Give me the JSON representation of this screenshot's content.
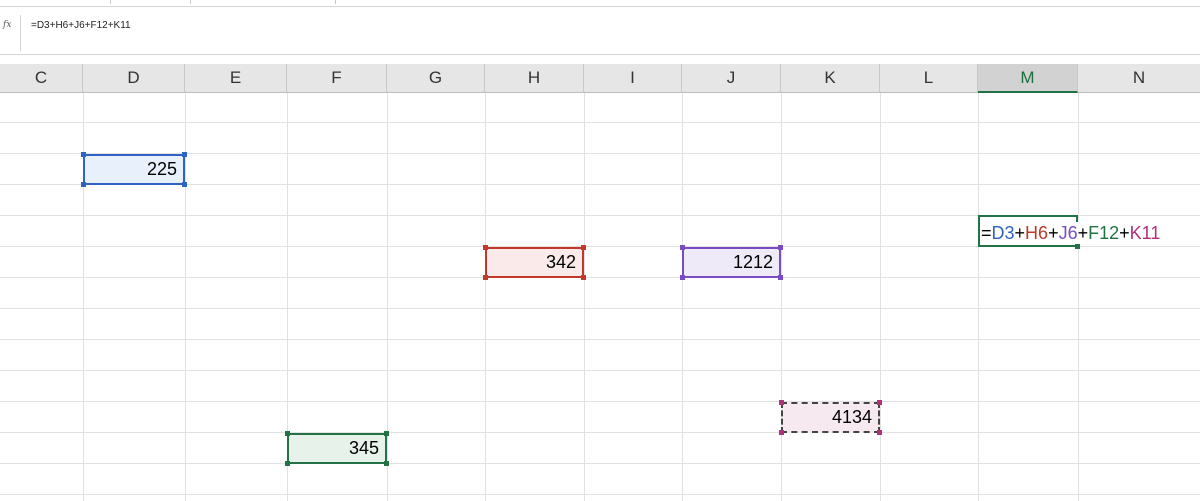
{
  "formula_bar": {
    "fx_label": "fx",
    "formula": "=D3+H6+J6+F12+K11"
  },
  "columns": [
    "C",
    "D",
    "E",
    "F",
    "G",
    "H",
    "I",
    "J",
    "K",
    "L",
    "M",
    "N"
  ],
  "selected_column": "M",
  "cells": {
    "D3": {
      "value": "225",
      "color": "#2e63c4",
      "fill": "#e8f0fb"
    },
    "H6": {
      "value": "342",
      "color": "#c0392b",
      "fill": "#fbeaea"
    },
    "J6": {
      "value": "1212",
      "color": "#7a4bc2",
      "fill": "#efeaf8"
    },
    "K11": {
      "value": "4134",
      "color": "#b0307a",
      "fill": "#f6e9ef"
    },
    "F12": {
      "value": "345",
      "color": "#217346",
      "fill": "#e6f2ea"
    }
  },
  "active_cell_formula": {
    "parts": [
      {
        "text": "=",
        "color": "#000000"
      },
      {
        "text": "D3",
        "color": "#2e63c4"
      },
      {
        "text": "+",
        "color": "#000000"
      },
      {
        "text": "H6",
        "color": "#c0392b"
      },
      {
        "text": "+",
        "color": "#000000"
      },
      {
        "text": "J6",
        "color": "#7a4bc2"
      },
      {
        "text": "+",
        "color": "#000000"
      },
      {
        "text": "F12",
        "color": "#217346"
      },
      {
        "text": "+",
        "color": "#000000"
      },
      {
        "text": "K11",
        "color": "#b0307a"
      }
    ]
  }
}
